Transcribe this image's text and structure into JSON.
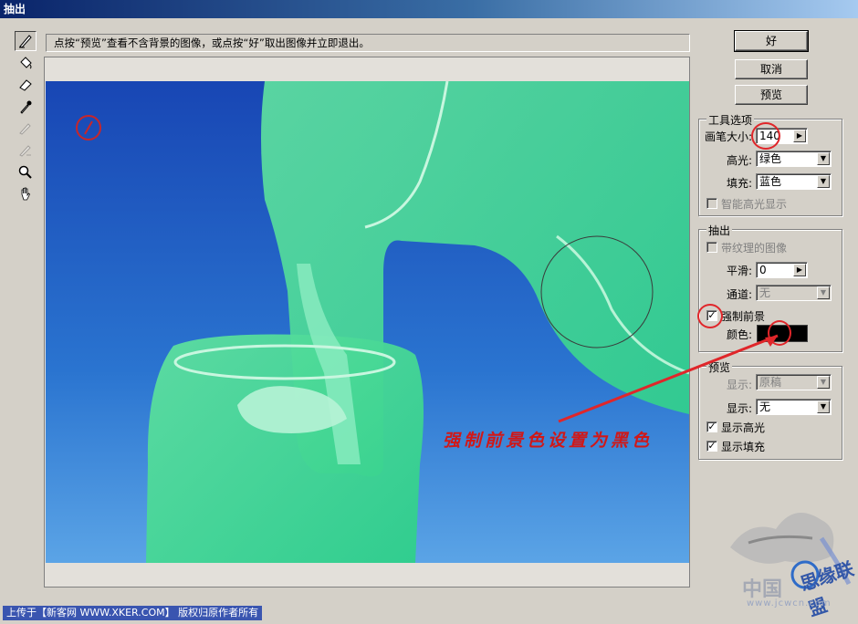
{
  "window": {
    "title": "抽出"
  },
  "hint": "点按“预览”查看不含背景的图像，或点按“好”取出图像并立即退出。",
  "buttons": {
    "ok": "好",
    "cancel": "取消",
    "preview": "预览"
  },
  "tools": [
    "edge-highlighter-icon",
    "fill-bucket-icon",
    "eraser-icon",
    "eyedropper-icon",
    "cleanup-tool-icon",
    "edge-touchup-icon",
    "zoom-icon",
    "hand-icon"
  ],
  "tool_options": {
    "title": "工具选项",
    "brush_size_label": "画笔大小:",
    "brush_size": "140",
    "highlight_label": "高光:",
    "highlight_value": "绿色",
    "fill_label": "填充:",
    "fill_value": "蓝色",
    "smart_highlight_label": "智能高光显示"
  },
  "extraction": {
    "title": "抽出",
    "textured_label": "带纹理的图像",
    "smooth_label": "平滑:",
    "smooth_value": "0",
    "channel_label": "通道:",
    "channel_value": "无",
    "force_fg_label": "强制前景",
    "color_label": "颜色:",
    "color_value": "#000000"
  },
  "preview": {
    "title": "预览",
    "show_label": "显示:",
    "show_value": "原稿",
    "display_label": "显示:",
    "display_value": "无",
    "show_highlight_label": "显示高光",
    "show_fill_label": "显示填充"
  },
  "annotation": "强制前景色设置为黑色",
  "footer": "上传于【新客网 WWW.XKER.COM】 版权归原作者所有",
  "watermark": {
    "text": "中国",
    "url": "www.jcwcn.com",
    "site": "思缘联盟"
  }
}
